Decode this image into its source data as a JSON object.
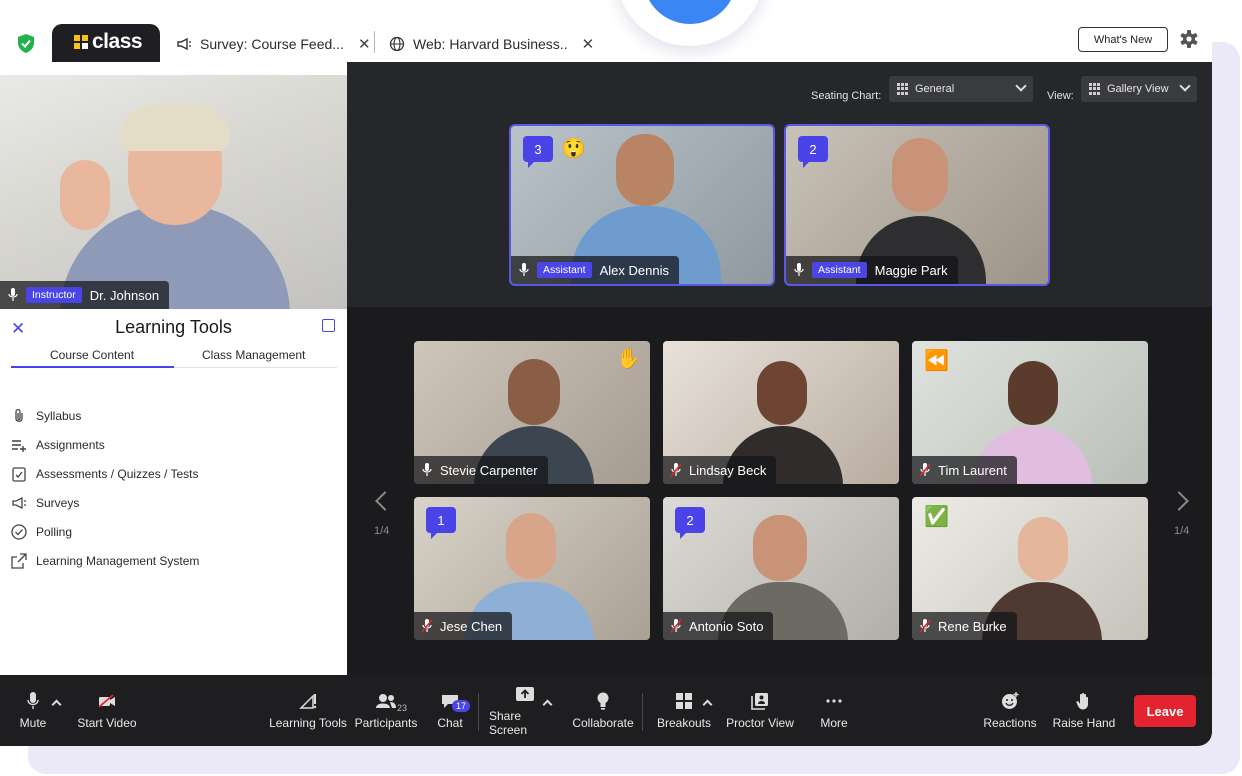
{
  "browser_tabs": [
    {
      "label": "class",
      "active": true
    },
    {
      "label": "Survey: Course Feed...",
      "icon": "megaphone-icon"
    },
    {
      "label": "Web: Harvard Business..",
      "icon": "globe-icon"
    }
  ],
  "header": {
    "whats_new": "What's New"
  },
  "controls": {
    "seating_label": "Seating Chart:",
    "seating_value": "General",
    "view_label": "View:",
    "view_value": "Gallery View"
  },
  "instructor": {
    "role": "Instructor",
    "name": "Dr. Johnson"
  },
  "assistants": [
    {
      "name": "Alex Dennis",
      "role": "Assistant",
      "chat_count": "3",
      "emoji": "😲"
    },
    {
      "name": "Maggie Park",
      "role": "Assistant",
      "chat_count": "2"
    }
  ],
  "students": [
    {
      "name": "Stevie Carpenter",
      "status": "✋",
      "muted": false
    },
    {
      "name": "Lindsay Beck",
      "muted": true
    },
    {
      "name": "Tim Laurent",
      "status": "⏪",
      "muted": true
    },
    {
      "name": "Jese Chen",
      "chat_count": "1",
      "muted": true
    },
    {
      "name": "Antonio Soto",
      "chat_count": "2",
      "muted": true
    },
    {
      "name": "Rene Burke",
      "status": "✅",
      "muted": true
    }
  ],
  "pagination": {
    "left": "1/4",
    "right": "1/4"
  },
  "learning_tools": {
    "title": "Learning Tools",
    "tabs": [
      "Course Content",
      "Class Management"
    ],
    "items": [
      {
        "label": "Syllabus",
        "icon": "paperclip-icon"
      },
      {
        "label": "Assignments",
        "icon": "assignments-icon"
      },
      {
        "label": "Assessments / Quizzes / Tests",
        "icon": "checklist-icon"
      },
      {
        "label": "Surveys",
        "icon": "megaphone-icon"
      },
      {
        "label": "Polling",
        "icon": "check-circle-icon"
      },
      {
        "label": "Learning Management System",
        "icon": "external-link-icon"
      }
    ]
  },
  "toolbar": {
    "mute": "Mute",
    "start_video": "Start Video",
    "learning_tools": "Learning Tools",
    "participants": "Participants",
    "participants_count": "23",
    "chat": "Chat",
    "chat_count": "17",
    "share_screen": "Share Screen",
    "collaborate": "Collaborate",
    "breakouts": "Breakouts",
    "proctor_view": "Proctor View",
    "more": "More",
    "reactions": "Reactions",
    "raise_hand": "Raise Hand",
    "leave": "Leave"
  },
  "colors": {
    "accent": "#4a44e8",
    "leave": "#e3232d",
    "zoom": "#3a86f5",
    "shield": "#22b14c"
  }
}
